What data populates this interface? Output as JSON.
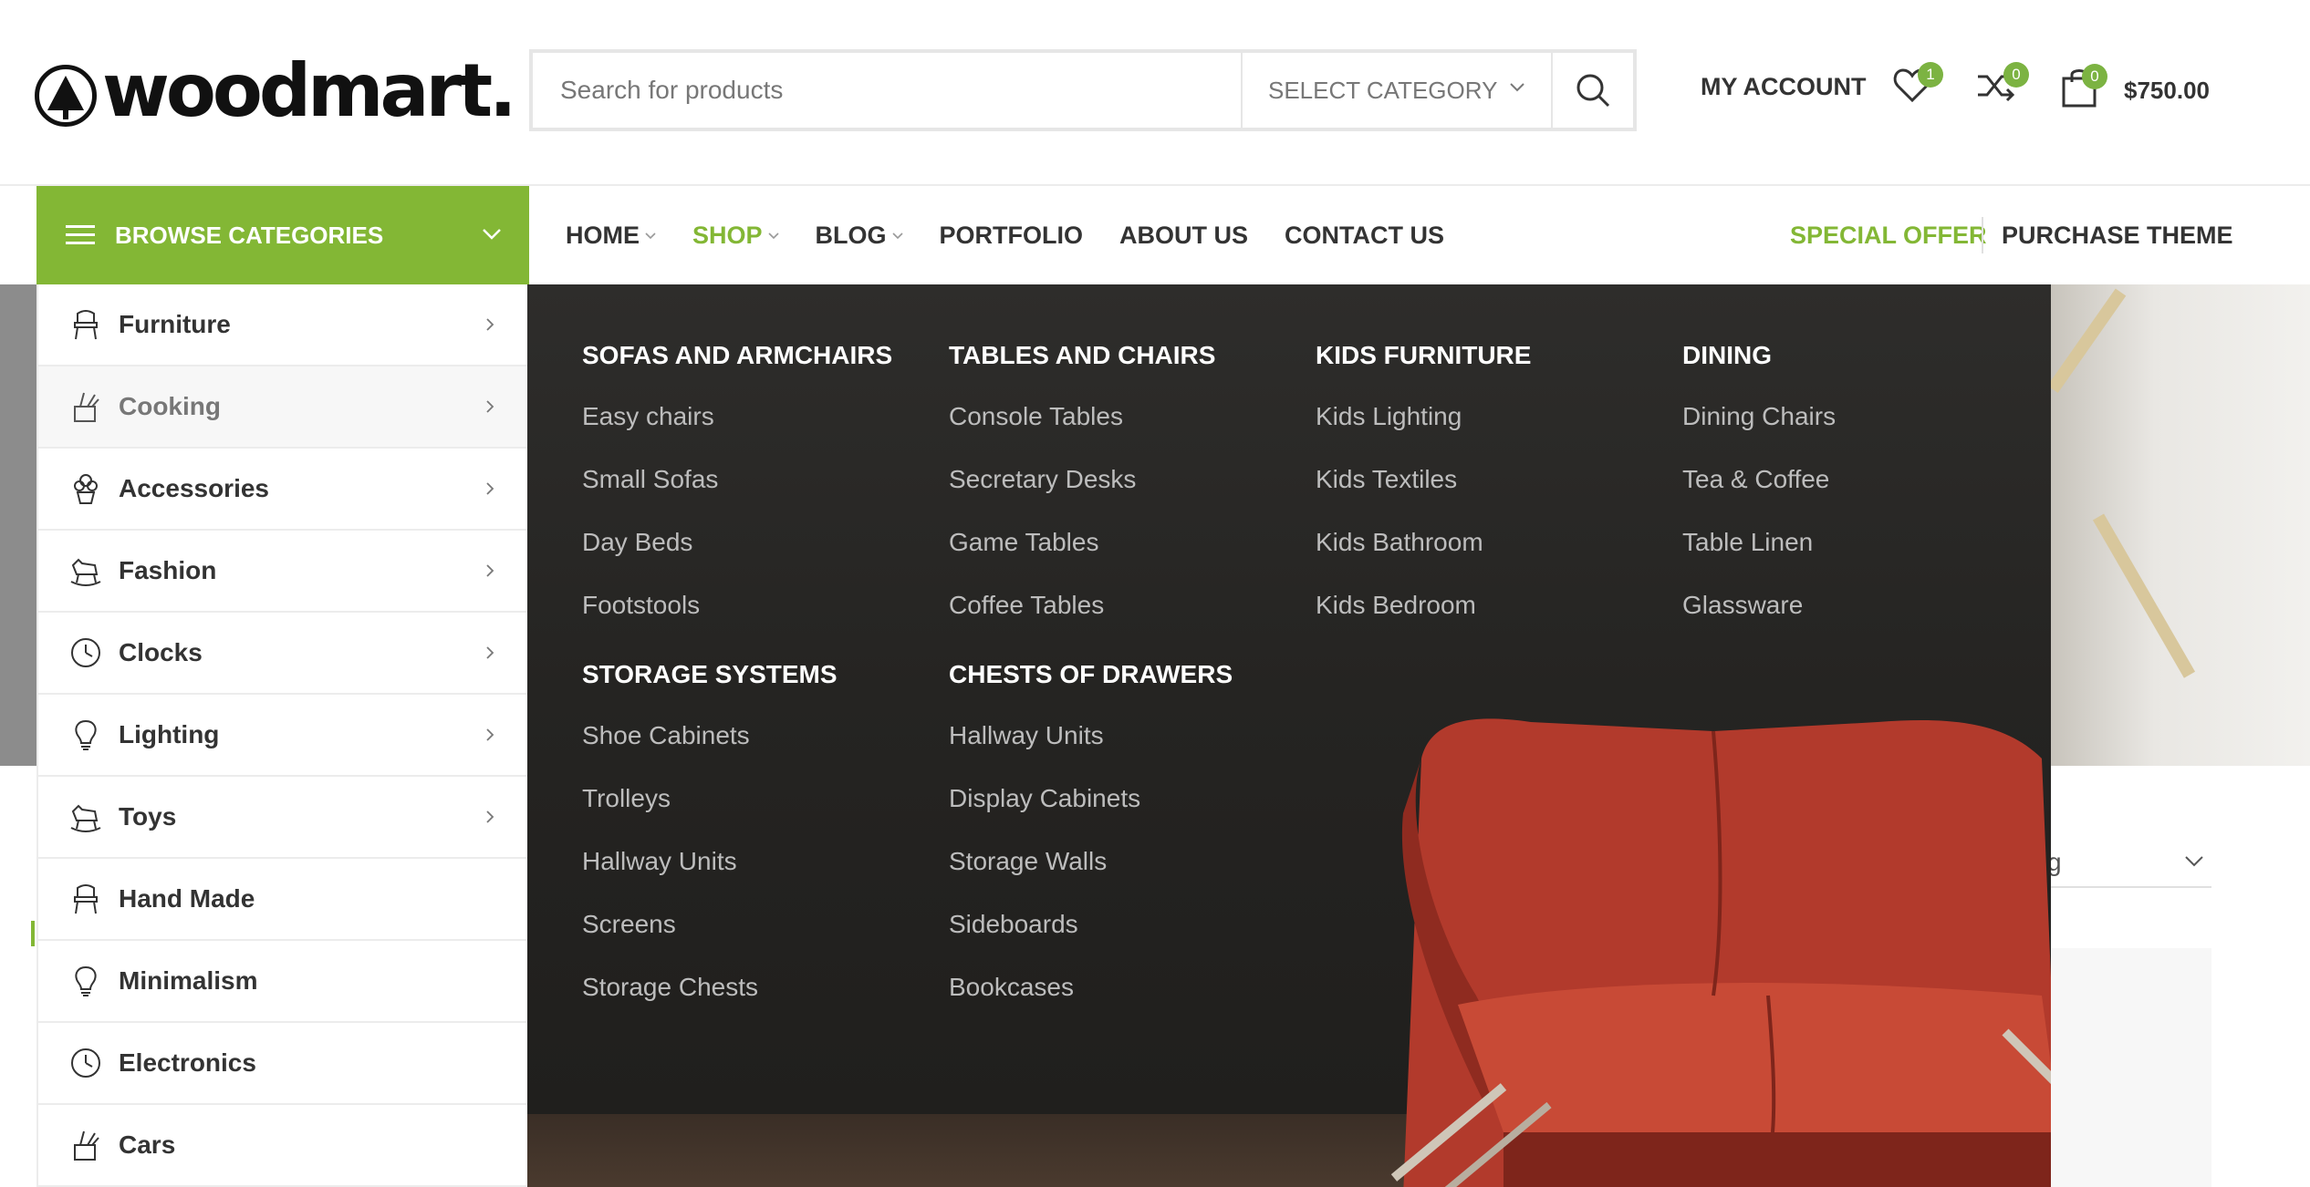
{
  "header": {
    "logo_text": "woodmart.",
    "search_placeholder": "Search for products",
    "select_category": "SELECT CATEGORY",
    "my_account": "MY ACCOUNT",
    "wishlist_count": "1",
    "compare_count": "0",
    "cart_count": "0",
    "cart_total": "$750.00"
  },
  "nav": {
    "browse_label": "BROWSE CATEGORIES",
    "items": [
      {
        "label": "HOME"
      },
      {
        "label": "SHOP"
      },
      {
        "label": "BLOG"
      },
      {
        "label": "PORTFOLIO"
      },
      {
        "label": "ABOUT US"
      },
      {
        "label": "CONTACT US"
      }
    ],
    "special_offer": "SPECIAL OFFER",
    "purchase_theme": "PURCHASE THEME"
  },
  "categories": [
    {
      "label": "Furniture",
      "icon": "chair-icon"
    },
    {
      "label": "Cooking",
      "icon": "kitchen-utensils-icon"
    },
    {
      "label": "Accessories",
      "icon": "plant-pot-icon"
    },
    {
      "label": "Fashion",
      "icon": "rocking-horse-icon"
    },
    {
      "label": "Clocks",
      "icon": "clock-icon"
    },
    {
      "label": "Lighting",
      "icon": "light-bulb-icon"
    },
    {
      "label": "Toys",
      "icon": "rocking-horse-icon"
    },
    {
      "label": "Hand Made",
      "icon": "chair-icon"
    },
    {
      "label": "Minimalism",
      "icon": "light-bulb-icon"
    },
    {
      "label": "Electronics",
      "icon": "clock-icon"
    },
    {
      "label": "Cars",
      "icon": "kitchen-utensils-icon"
    }
  ],
  "mega_menu": {
    "sofas": {
      "title": "SOFAS AND ARMCHAIRS",
      "links": [
        "Easy chairs",
        "Small Sofas",
        "Day Beds",
        "Footstools"
      ]
    },
    "storage": {
      "title": "STORAGE SYSTEMS",
      "links": [
        "Shoe Cabinets",
        "Trolleys",
        "Hallway Units",
        "Screens",
        "Storage Chests"
      ]
    },
    "tables": {
      "title": "TABLES AND CHAIRS",
      "links": [
        "Console Tables",
        "Secretary Desks",
        "Game Tables",
        "Coffee Tables"
      ]
    },
    "chests": {
      "title": "CHESTS OF DRAWERS",
      "links": [
        "Hallway Units",
        "Display Cabinets",
        "Storage Walls",
        "Sideboards",
        "Bookcases"
      ]
    },
    "kids": {
      "title": "KIDS FURNITURE",
      "links": [
        "Kids Lighting",
        "Kids Textiles",
        "Kids Bathroom",
        "Kids Bedroom"
      ]
    },
    "dining": {
      "title": "DINING",
      "links": [
        "Dining Chairs",
        "Tea & Coffee",
        "Table Linen",
        "Glassware"
      ]
    }
  },
  "background": {
    "sort_text": "g"
  },
  "colors": {
    "accent": "#83b735",
    "mega_bg": "#252422",
    "badge": "#7cb342"
  }
}
